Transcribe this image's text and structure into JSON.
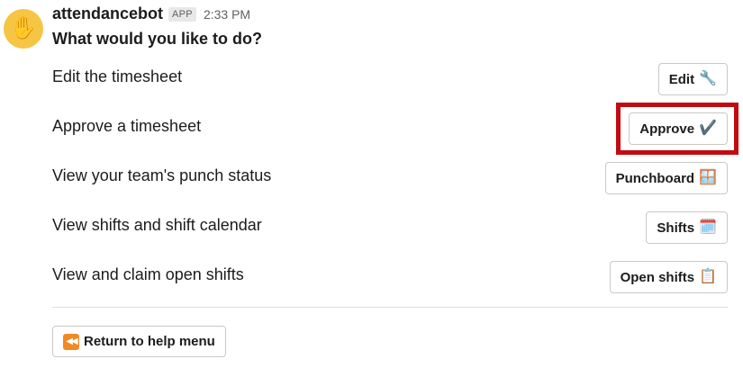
{
  "message": {
    "sender": "attendancebot",
    "badge": "APP",
    "time": "2:33 PM",
    "question": "What would you like to do?",
    "avatar_icon": "raised-hand-icon",
    "avatar_color": "#f6c544"
  },
  "options": [
    {
      "label": "Edit the timesheet",
      "button": "Edit",
      "icon": "wrench-icon",
      "glyph": "🔧"
    },
    {
      "label": "Approve a timesheet",
      "button": "Approve",
      "icon": "check-mark-icon",
      "glyph": "✔️",
      "highlighted": true
    },
    {
      "label": "View your team's punch status",
      "button": "Punchboard",
      "icon": "window-icon",
      "glyph": "🪟"
    },
    {
      "label": "View shifts and shift calendar",
      "button": "Shifts",
      "icon": "calendar-icon",
      "glyph": "🗓️"
    },
    {
      "label": "View and claim open shifts",
      "button": "Open shifts",
      "icon": "clipboard-icon",
      "glyph": "📋"
    }
  ],
  "footer": {
    "help_button": "Return to help menu",
    "help_icon": "rewind-icon",
    "help_glyph": "⏪"
  },
  "colors": {
    "highlight": "#c10b11",
    "text": "#1d1c1d",
    "muted": "#616061",
    "border": "#c9c9c9"
  }
}
